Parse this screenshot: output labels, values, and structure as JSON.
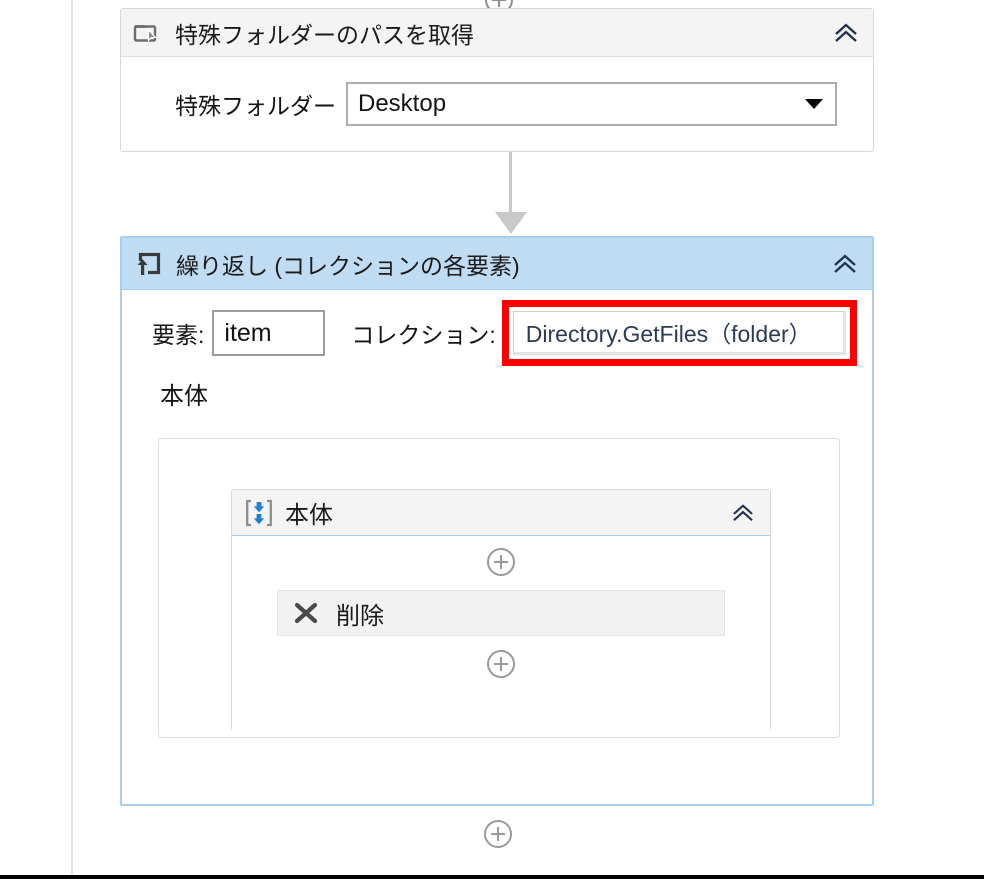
{
  "colors": {
    "highlight_red": "#fe0000",
    "loop_header_bg": "#bfdcf2",
    "loop_border": "#a8d0ee",
    "card_header_bg": "#f4f4f4",
    "body_icon_blue": "#1f7fd0",
    "connector_gray": "#c9c9c9"
  },
  "special_folder_card": {
    "icon": "folder-cursor-icon",
    "title": "特殊フォルダーのパスを取得",
    "collapse_icon": "double-chevron-up-icon",
    "field": {
      "label": "特殊フォルダー",
      "value": "Desktop",
      "dropdown_icon": "triangle-down-icon"
    }
  },
  "connector": {
    "icon": "arrow-down-connector"
  },
  "loop_card": {
    "icon": "loop-repeat-icon",
    "title": "繰り返し (コレクションの各要素)",
    "collapse_icon": "double-chevron-up-icon",
    "element": {
      "label": "要素:",
      "value": "item"
    },
    "collection": {
      "label": "コレクション:",
      "value": "Directory.GetFiles（folder）",
      "highlighted": true
    },
    "body_section_label": "本体",
    "inner_card": {
      "icon": "bracket-down-arrows-icon",
      "title": "本体",
      "collapse_icon": "double-chevron-up-icon",
      "add_top_icon": "plus-circle-icon",
      "action": {
        "icon": "x-delete-icon",
        "label": "削除"
      },
      "add_bottom_icon": "plus-circle-icon"
    }
  },
  "bottom_add": {
    "icon": "plus-circle-icon"
  },
  "top_clipped_add": {
    "icon": "plus-circle-icon"
  }
}
